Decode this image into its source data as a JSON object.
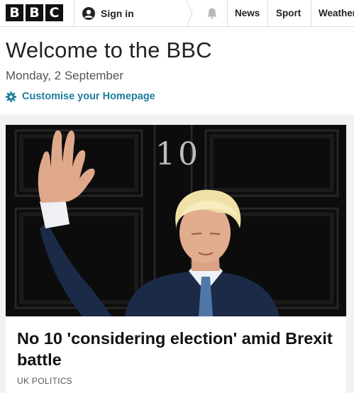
{
  "brand": {
    "letters": [
      "B",
      "B",
      "C"
    ]
  },
  "header": {
    "signin_label": "Sign in",
    "nav": [
      {
        "label": "News"
      },
      {
        "label": "Sport"
      },
      {
        "label": "Weather"
      }
    ]
  },
  "welcome": {
    "title": "Welcome to the BBC",
    "date": "Monday, 2 September",
    "customise_label": "Customise your Homepage"
  },
  "promo": {
    "headline": "No 10 'considering election' amid Brexit battle",
    "category": "UK POLITICS",
    "door_number": "10"
  },
  "colors": {
    "accent": "#1d7e9c",
    "door": "#0c0c0c"
  }
}
